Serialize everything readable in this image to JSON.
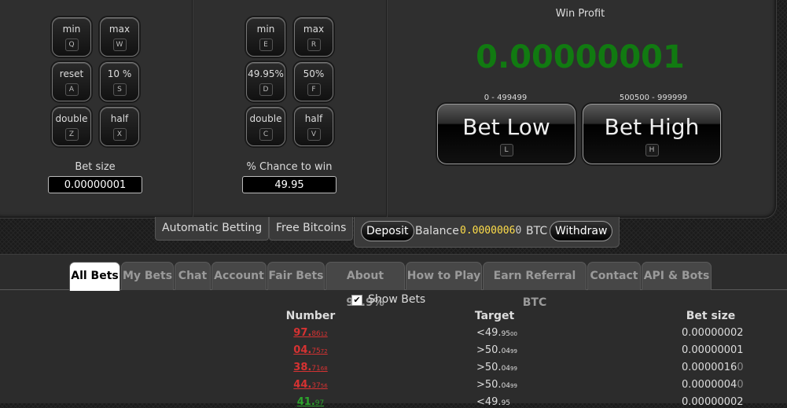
{
  "left_panel": {
    "buttons": [
      {
        "label": "min",
        "key": "Q"
      },
      {
        "label": "max",
        "key": "W"
      },
      {
        "label": "reset",
        "key": "A"
      },
      {
        "label": "10 %",
        "key": "S"
      },
      {
        "label": "double",
        "key": "Z"
      },
      {
        "label": "half",
        "key": "X"
      }
    ],
    "field_label": "Bet size",
    "field_value": "0.00000001"
  },
  "mid_panel": {
    "buttons": [
      {
        "label": "min",
        "key": "E"
      },
      {
        "label": "max",
        "key": "R"
      },
      {
        "label": "49.95%",
        "key": "D"
      },
      {
        "label": "50%",
        "key": "F"
      },
      {
        "label": "double",
        "key": "C"
      },
      {
        "label": "half",
        "key": "V"
      }
    ],
    "field_label": "% Chance to win",
    "field_value": "49.95"
  },
  "right_panel": {
    "title": "Win Profit",
    "profit": "0.00000001",
    "profit_color": "#117a11",
    "bet_low": {
      "range": "0 - 499499",
      "label": "Bet Low",
      "key": "L"
    },
    "bet_high": {
      "range": "500500 - 999999",
      "label": "Bet High",
      "key": "H"
    }
  },
  "actions": {
    "automatic": "Automatic Betting",
    "free": "Free Bitcoins",
    "deposit": "Deposit",
    "balance_label": "Balance",
    "balance_bright": "0.0000006",
    "balance_dim": "0",
    "currency": "BTC",
    "withdraw": "Withdraw"
  },
  "tabs": [
    "All Bets",
    "My Bets",
    "Chat",
    "Account",
    "Fair Bets",
    "About 99.9%",
    "How to Play",
    "Earn Referral BTC",
    "Contact",
    "API & Bots"
  ],
  "active_tab": "All Bets",
  "show_bets_label": "Show Bets",
  "show_bets_checked": true,
  "table": {
    "headers": [
      "Number",
      "Target",
      "Bet size"
    ],
    "rows": [
      {
        "number_big": "97.",
        "number_small": "86",
        "number_tiny": "12",
        "number_color": "#d63232",
        "target": "<49.",
        "target_small": "95",
        "target_tiny": "00",
        "bet_size": "0.00000002",
        "bet_size_dim": ""
      },
      {
        "number_big": "04.",
        "number_small": "75",
        "number_tiny": "72",
        "number_color": "#d63232",
        "target": ">50.",
        "target_small": "04",
        "target_tiny": "99",
        "bet_size": "0.00000001",
        "bet_size_dim": ""
      },
      {
        "number_big": "38.",
        "number_small": "71",
        "number_tiny": "68",
        "number_color": "#d63232",
        "target": ">50.",
        "target_small": "04",
        "target_tiny": "99",
        "bet_size": "0.0000016",
        "bet_size_dim": "0"
      },
      {
        "number_big": "44.",
        "number_small": "37",
        "number_tiny": "56",
        "number_color": "#d63232",
        "target": ">50.",
        "target_small": "04",
        "target_tiny": "99",
        "bet_size": "0.0000004",
        "bet_size_dim": "0"
      },
      {
        "number_big": "41.",
        "number_small": "97",
        "number_tiny": "",
        "number_color": "#2da52d",
        "target": "<49.",
        "target_small": "95",
        "target_tiny": "",
        "bet_size": "0.00000002",
        "bet_size_dim": ""
      }
    ]
  }
}
